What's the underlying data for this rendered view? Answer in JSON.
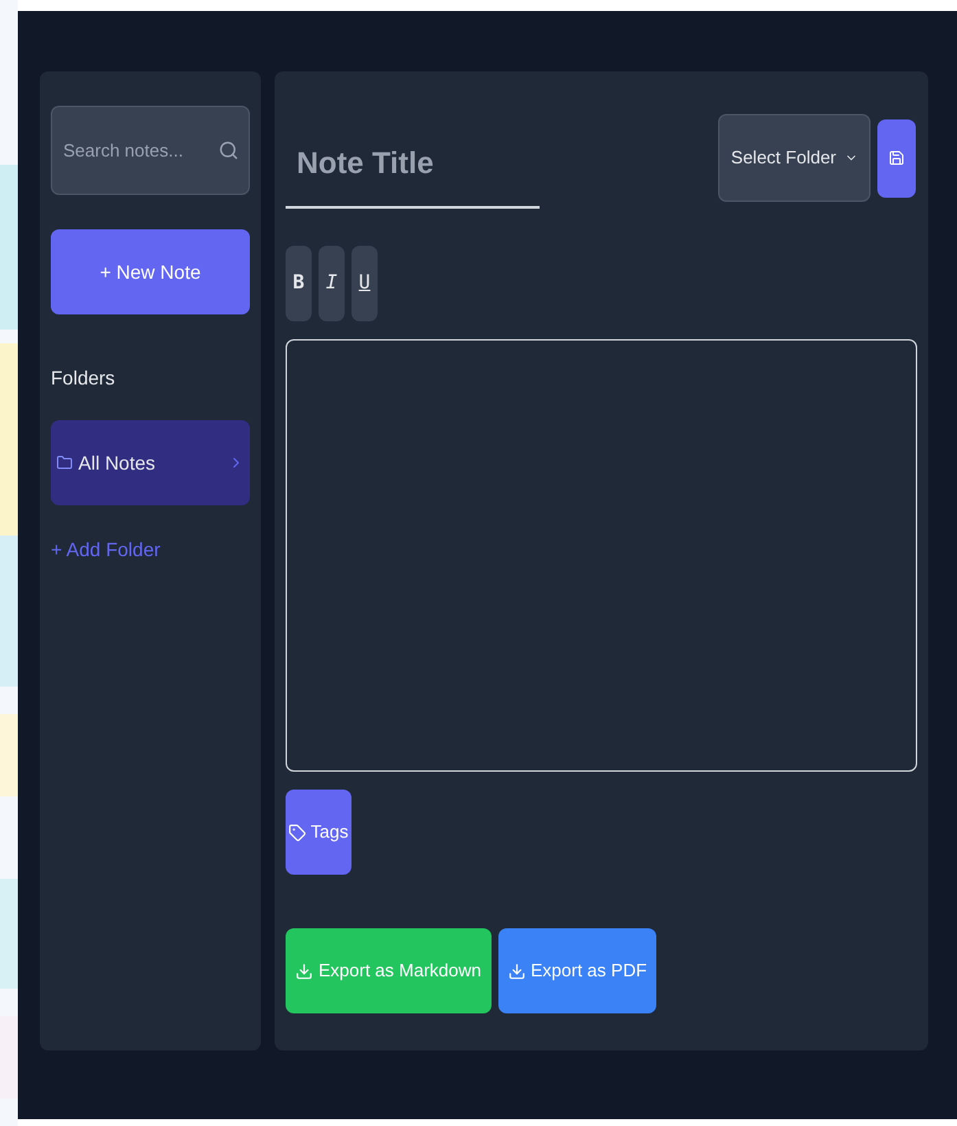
{
  "sidebar": {
    "search": {
      "placeholder": "Search notes..."
    },
    "new_note": "+ New Note",
    "folders_heading": "Folders",
    "folders": [
      {
        "label": "All Notes",
        "selected": true
      }
    ],
    "add_folder": "+ Add Folder"
  },
  "editor": {
    "title": {
      "placeholder": "Note Title"
    },
    "folder_select": "Select Folder",
    "format_buttons": [
      {
        "label": "B",
        "kind": "bold"
      },
      {
        "label": "I",
        "kind": "italic"
      },
      {
        "label": "U",
        "kind": "underline"
      }
    ],
    "tags": "Tags",
    "exports": [
      {
        "label": "Export as Markdown",
        "kind": "markdown"
      },
      {
        "label": "Export as PDF",
        "kind": "pdf"
      }
    ]
  }
}
